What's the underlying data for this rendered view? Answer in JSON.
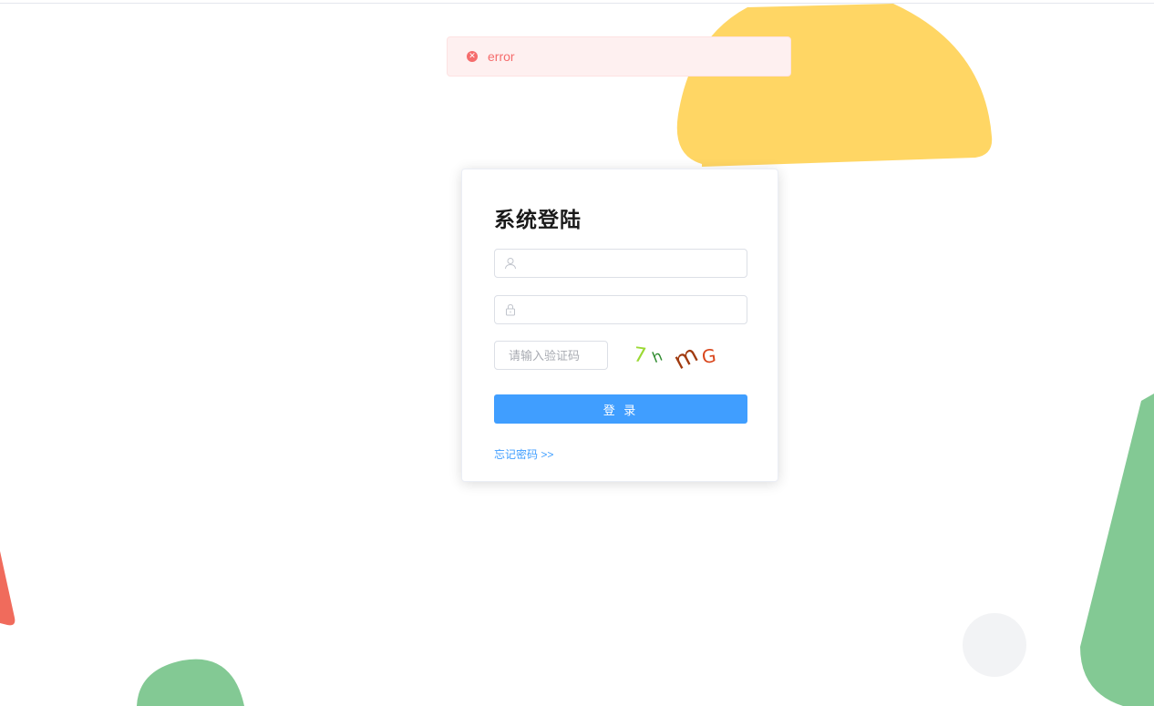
{
  "message": {
    "type": "error",
    "text": "error",
    "icon": "error-circle-icon",
    "color": "#f56c6c"
  },
  "login": {
    "title": "系统登陆",
    "username": {
      "value": "",
      "placeholder": "",
      "icon": "user-icon"
    },
    "password": {
      "value": "",
      "placeholder": "",
      "icon": "lock-icon"
    },
    "captcha": {
      "placeholder": "请输入验证码",
      "chars": [
        "7",
        "h",
        "m",
        "G"
      ]
    },
    "submit_label": "登 录",
    "forgot_label": "忘记密码 >>"
  },
  "colors": {
    "primary": "#409eff",
    "decor_yellow": "#ffd664",
    "decor_green": "#83c994",
    "decor_red": "#f06b5c",
    "decor_grey": "#f2f3f5"
  }
}
